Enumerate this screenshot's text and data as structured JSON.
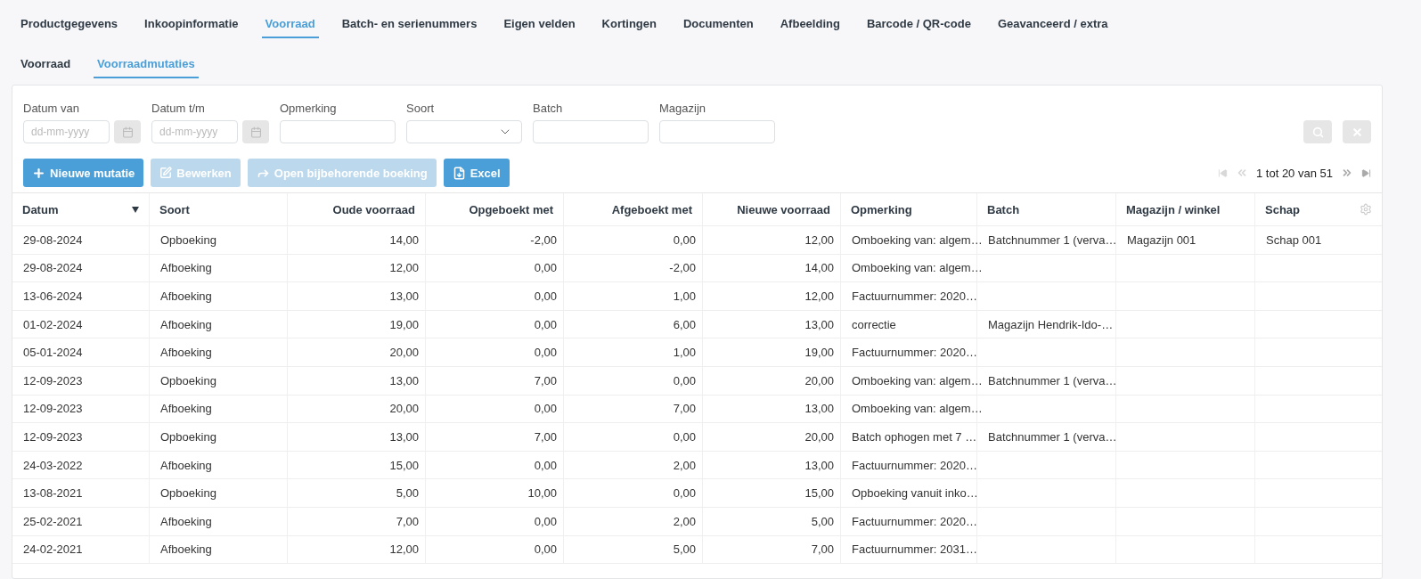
{
  "tabs": [
    {
      "label": "Productgegevens",
      "selected": false
    },
    {
      "label": "Inkoopinformatie",
      "selected": false
    },
    {
      "label": "Voorraad",
      "selected": true
    },
    {
      "label": "Batch- en serienummers",
      "selected": false
    },
    {
      "label": "Eigen velden",
      "selected": false
    },
    {
      "label": "Kortingen",
      "selected": false
    },
    {
      "label": "Documenten",
      "selected": false
    },
    {
      "label": "Afbeelding",
      "selected": false
    },
    {
      "label": "Barcode / QR-code",
      "selected": false
    },
    {
      "label": "Geavanceerd / extra",
      "selected": false
    }
  ],
  "subtabs": [
    {
      "label": "Voorraad",
      "selected": false
    },
    {
      "label": "Voorraadmutaties",
      "selected": true
    }
  ],
  "filters": [
    {
      "kind": "date",
      "label": "Datum van",
      "placeholder": "dd-mm-yyyy"
    },
    {
      "kind": "date",
      "label": "Datum t/m",
      "placeholder": "dd-mm-yyyy"
    },
    {
      "kind": "text",
      "label": "Opmerking"
    },
    {
      "kind": "select",
      "label": "Soort"
    },
    {
      "kind": "text",
      "label": "Batch"
    },
    {
      "kind": "text",
      "label": "Magazijn"
    }
  ],
  "actions": [
    {
      "kind": "add",
      "label": "Nieuwe mutatie",
      "disabled": false
    },
    {
      "kind": "edit",
      "label": "Bewerken",
      "disabled": true
    },
    {
      "kind": "open",
      "label": "Open bijbehorende boeking",
      "disabled": true
    },
    {
      "kind": "excel",
      "label": "Excel",
      "disabled": false
    }
  ],
  "pagination": {
    "text": "1 tot 20 van 51",
    "first_disabled": true,
    "prev_disabled": true,
    "next_disabled": false,
    "last_disabled": false
  },
  "table": {
    "columns": [
      {
        "label": "Datum",
        "kind": "text",
        "sorted": true
      },
      {
        "label": "Soort",
        "kind": "text",
        "sorted": false
      },
      {
        "label": "Oude voorraad",
        "kind": "number",
        "sorted": false
      },
      {
        "label": "Opgeboekt met",
        "kind": "number",
        "sorted": false
      },
      {
        "label": "Afgeboekt met",
        "kind": "number",
        "sorted": false
      },
      {
        "label": "Nieuwe voorraad",
        "kind": "number",
        "sorted": false
      },
      {
        "label": "Opmerking",
        "kind": "text",
        "sorted": false
      },
      {
        "label": "Batch",
        "kind": "text",
        "sorted": false
      },
      {
        "label": "Magazijn / winkel",
        "kind": "text",
        "sorted": false
      },
      {
        "label": "Schap",
        "kind": "text",
        "sorted": false
      }
    ],
    "rows": [
      [
        "29-08-2024",
        "Opboeking",
        "14,00",
        "-2,00",
        "0,00",
        "12,00",
        "Omboeking van: algem…",
        "Batchnummer 1 (verva…",
        "Magazijn 001",
        "Schap 001"
      ],
      [
        "29-08-2024",
        "Afboeking",
        "12,00",
        "0,00",
        "-2,00",
        "14,00",
        "Omboeking van: algem…",
        null,
        null,
        null
      ],
      [
        "13-06-2024",
        "Afboeking",
        "13,00",
        "0,00",
        "1,00",
        "12,00",
        "Factuurnummer: 2020…",
        null,
        null,
        null
      ],
      [
        "01-02-2024",
        "Afboeking",
        "19,00",
        "0,00",
        "6,00",
        "13,00",
        "correctie",
        "Magazijn Hendrik-Ido-…",
        null,
        null
      ],
      [
        "05-01-2024",
        "Afboeking",
        "20,00",
        "0,00",
        "1,00",
        "19,00",
        "Factuurnummer: 2020…",
        null,
        null,
        null
      ],
      [
        "12-09-2023",
        "Opboeking",
        "13,00",
        "7,00",
        "0,00",
        "20,00",
        "Omboeking van: algem…",
        "Batchnummer 1 (verva…",
        null,
        null
      ],
      [
        "12-09-2023",
        "Afboeking",
        "20,00",
        "0,00",
        "7,00",
        "13,00",
        "Omboeking van: algem…",
        null,
        null,
        null
      ],
      [
        "12-09-2023",
        "Opboeking",
        "13,00",
        "7,00",
        "0,00",
        "20,00",
        "Batch ophogen met 7 …",
        "Batchnummer 1 (verva…",
        null,
        null
      ],
      [
        "24-03-2022",
        "Afboeking",
        "15,00",
        "0,00",
        "2,00",
        "13,00",
        "Factuurnummer: 2020…",
        null,
        null,
        null
      ],
      [
        "13-08-2021",
        "Opboeking",
        "5,00",
        "10,00",
        "0,00",
        "15,00",
        "Opboeking vanuit inko…",
        null,
        null,
        null
      ],
      [
        "25-02-2021",
        "Afboeking",
        "7,00",
        "0,00",
        "2,00",
        "5,00",
        "Factuurnummer: 2020…",
        null,
        null,
        null
      ],
      [
        "24-02-2021",
        "Afboeking",
        "12,00",
        "0,00",
        "5,00",
        "7,00",
        "Factuurnummer: 2031…",
        null,
        null,
        null
      ]
    ]
  }
}
